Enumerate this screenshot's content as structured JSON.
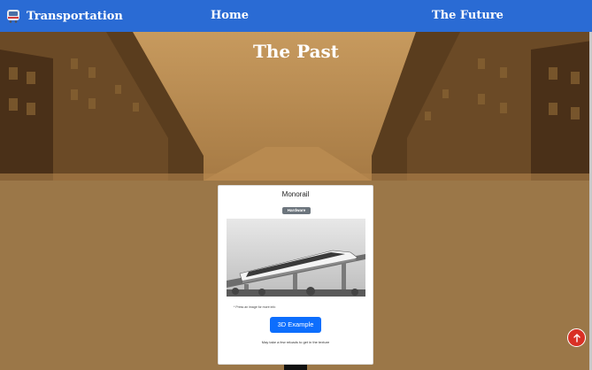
{
  "navbar": {
    "brand_icon": "tram-icon",
    "brand_label": "Transportation",
    "home_label": "Home",
    "future_label": "The Future",
    "accent": "#2a6bd4"
  },
  "hero": {
    "title": "The Past"
  },
  "card": {
    "title": "Monorail",
    "badge": "Hardware",
    "image_subject": "monorail-train-image",
    "hint": "* Press an image for more info",
    "button_label": "3D Example",
    "note": "May take a few reloads to get in the texture"
  },
  "colors": {
    "page_background": "#9b7748",
    "button": "#0d6efd",
    "scroll_top_button": "#d93025"
  },
  "scroll_top_icon": "arrow-up-icon"
}
